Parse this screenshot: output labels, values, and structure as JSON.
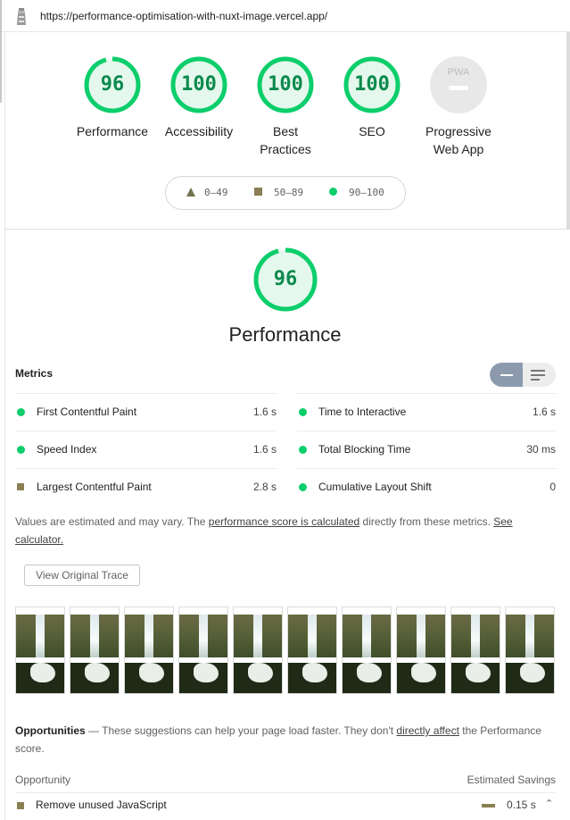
{
  "url": "https://performance-optimisation-with-nuxt-image.vercel.app/",
  "categories": [
    {
      "score": "96",
      "label": "Performance"
    },
    {
      "score": "100",
      "label": "Accessibility"
    },
    {
      "score": "100",
      "label": "Best Practices"
    },
    {
      "score": "100",
      "label": "SEO"
    },
    {
      "score": "PWA",
      "label": "Progressive Web App"
    }
  ],
  "legend": {
    "fail": "0–49",
    "average": "50–89",
    "pass": "90–100"
  },
  "perf": {
    "score": "96",
    "title": "Performance"
  },
  "metrics_heading": "Metrics",
  "metrics": [
    {
      "name": "First Contentful Paint",
      "value": "1.6 s",
      "status": "pass"
    },
    {
      "name": "Time to Interactive",
      "value": "1.6 s",
      "status": "pass"
    },
    {
      "name": "Speed Index",
      "value": "1.6 s",
      "status": "pass"
    },
    {
      "name": "Total Blocking Time",
      "value": "30 ms",
      "status": "pass"
    },
    {
      "name": "Largest Contentful Paint",
      "value": "2.8 s",
      "status": "average"
    },
    {
      "name": "Cumulative Layout Shift",
      "value": "0",
      "status": "pass"
    }
  ],
  "note": {
    "pre": "Values are estimated and may vary. The ",
    "link1": "performance score is calculated",
    "mid": " directly from these metrics. ",
    "link2": "See calculator."
  },
  "trace_button": "View Original Trace",
  "opportunities": {
    "title": "Opportunities",
    "pre": " — These suggestions can help your page load faster. They don't ",
    "link": "directly affect",
    "post": " the Performance score.",
    "col_left": "Opportunity",
    "col_right": "Estimated Savings",
    "rows": [
      {
        "name": "Remove unused JavaScript",
        "value": "0.15 s"
      }
    ]
  },
  "colors": {
    "pass": "#0cce6b",
    "average": "#8a7f53",
    "pass_text": "#0c8a4d",
    "fail": "#74734f"
  }
}
